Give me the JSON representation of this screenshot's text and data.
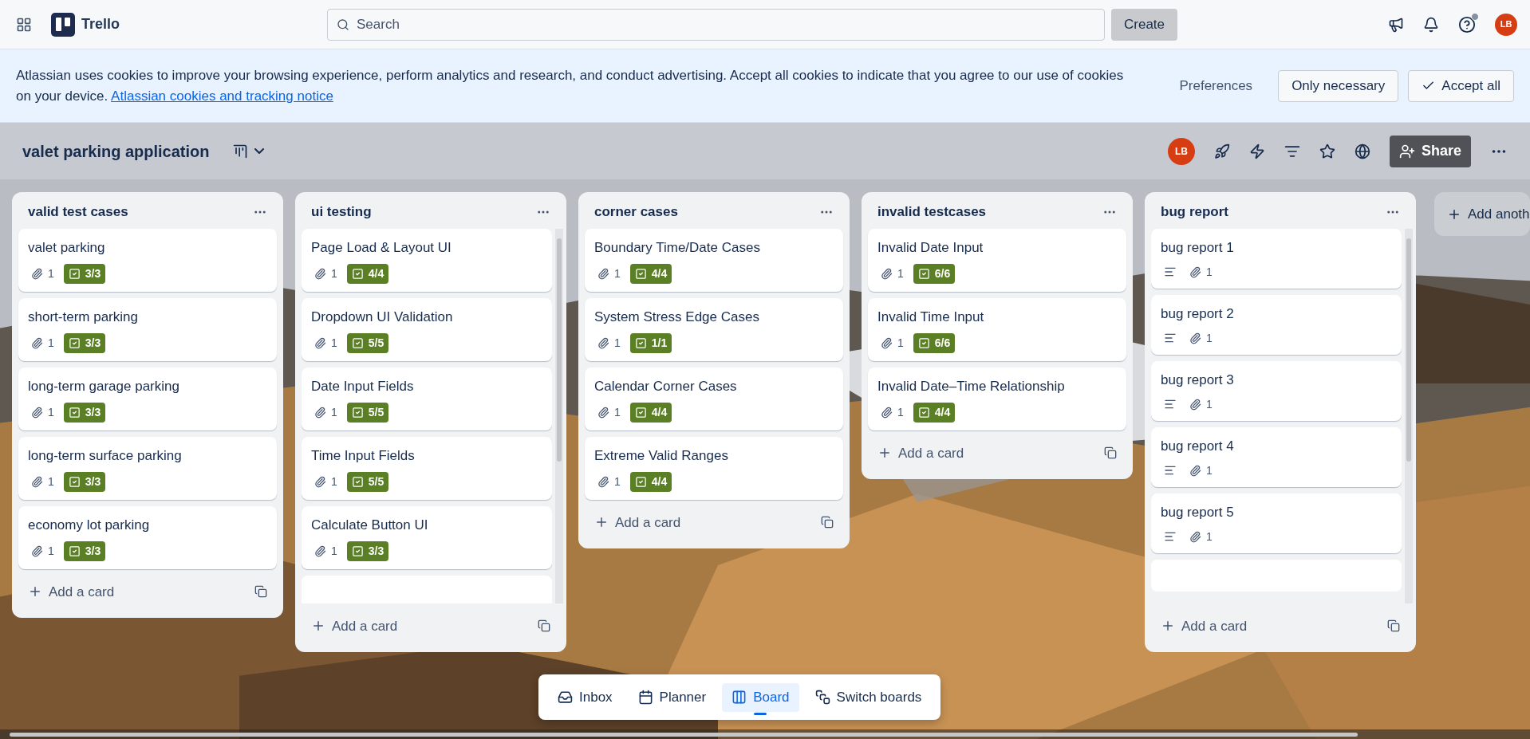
{
  "topbar": {
    "product": "Trello",
    "search": {
      "placeholder": "Search"
    },
    "create": "Create",
    "avatar": "LB",
    "help_dot": true
  },
  "cookie_banner": {
    "text": "Atlassian uses cookies to improve your browsing experience, perform analytics and research, and conduct advertising. Accept all cookies to indicate that you agree to our use of cookies on your device.",
    "link": "Atlassian cookies and tracking notice",
    "buttons": [
      {
        "label": "Preferences",
        "kind": "link"
      },
      {
        "label": "Only necessary",
        "kind": "outline"
      },
      {
        "label": "Accept all",
        "kind": "check"
      }
    ]
  },
  "board": {
    "title": "valet parking application",
    "avatar": "LB",
    "share": "Share"
  },
  "lists": [
    {
      "title": "valid test cases",
      "scroll": false,
      "add": "Add a card",
      "cards": [
        {
          "title": "valet parking",
          "badges": [
            {
              "kind": "attachment",
              "text": "1"
            },
            {
              "kind": "checklist",
              "text": "3/3"
            }
          ]
        },
        {
          "title": "short-term parking",
          "badges": [
            {
              "kind": "attachment",
              "text": "1"
            },
            {
              "kind": "checklist",
              "text": "3/3"
            }
          ]
        },
        {
          "title": "long-term garage parking",
          "badges": [
            {
              "kind": "attachment",
              "text": "1"
            },
            {
              "kind": "checklist",
              "text": "3/3"
            }
          ]
        },
        {
          "title": "long-term surface parking",
          "badges": [
            {
              "kind": "attachment",
              "text": "1"
            },
            {
              "kind": "checklist",
              "text": "3/3"
            }
          ]
        },
        {
          "title": "economy lot parking",
          "badges": [
            {
              "kind": "attachment",
              "text": "1"
            },
            {
              "kind": "checklist",
              "text": "3/3"
            }
          ]
        }
      ]
    },
    {
      "title": "ui testing",
      "scroll": true,
      "add": "Add a card",
      "cards": [
        {
          "title": "Page Load & Layout UI",
          "badges": [
            {
              "kind": "attachment",
              "text": "1"
            },
            {
              "kind": "checklist",
              "text": "4/4"
            }
          ]
        },
        {
          "title": "Dropdown UI Validation",
          "badges": [
            {
              "kind": "attachment",
              "text": "1"
            },
            {
              "kind": "checklist",
              "text": "5/5"
            }
          ]
        },
        {
          "title": "Date Input Fields",
          "badges": [
            {
              "kind": "attachment",
              "text": "1"
            },
            {
              "kind": "checklist",
              "text": "5/5"
            }
          ]
        },
        {
          "title": "Time Input Fields",
          "badges": [
            {
              "kind": "attachment",
              "text": "1"
            },
            {
              "kind": "checklist",
              "text": "5/5"
            }
          ]
        },
        {
          "title": "Calculate Button UI",
          "badges": [
            {
              "kind": "attachment",
              "text": "1"
            },
            {
              "kind": "checklist",
              "text": "3/3"
            }
          ]
        }
      ]
    },
    {
      "title": "corner cases",
      "scroll": false,
      "add": "Add a card",
      "cards": [
        {
          "title": "Boundary Time/Date Cases",
          "badges": [
            {
              "kind": "attachment",
              "text": "1"
            },
            {
              "kind": "checklist",
              "text": "4/4"
            }
          ]
        },
        {
          "title": "System Stress Edge Cases",
          "badges": [
            {
              "kind": "attachment",
              "text": "1"
            },
            {
              "kind": "checklist",
              "text": "1/1"
            }
          ]
        },
        {
          "title": "Calendar Corner Cases",
          "badges": [
            {
              "kind": "attachment",
              "text": "1"
            },
            {
              "kind": "checklist",
              "text": "4/4"
            }
          ]
        },
        {
          "title": "Extreme Valid Ranges",
          "badges": [
            {
              "kind": "attachment",
              "text": "1"
            },
            {
              "kind": "checklist",
              "text": "4/4"
            }
          ]
        }
      ]
    },
    {
      "title": "invalid testcases",
      "scroll": false,
      "add": "Add a card",
      "cards": [
        {
          "title": "Invalid Date Input",
          "badges": [
            {
              "kind": "attachment",
              "text": "1"
            },
            {
              "kind": "checklist",
              "text": "6/6"
            }
          ]
        },
        {
          "title": "Invalid Time Input",
          "badges": [
            {
              "kind": "attachment",
              "text": "1"
            },
            {
              "kind": "checklist",
              "text": "6/6"
            }
          ]
        },
        {
          "title": "Invalid Date–Time Relationship",
          "badges": [
            {
              "kind": "attachment",
              "text": "1"
            },
            {
              "kind": "checklist",
              "text": "4/4"
            }
          ]
        }
      ]
    },
    {
      "title": "bug report",
      "scroll": true,
      "add": "Add a card",
      "cards": [
        {
          "title": "bug report 1",
          "badges": [
            {
              "kind": "description"
            },
            {
              "kind": "attachment",
              "text": "1"
            }
          ]
        },
        {
          "title": "bug report 2",
          "badges": [
            {
              "kind": "description"
            },
            {
              "kind": "attachment",
              "text": "1"
            }
          ]
        },
        {
          "title": "bug report 3",
          "badges": [
            {
              "kind": "description"
            },
            {
              "kind": "attachment",
              "text": "1"
            }
          ]
        },
        {
          "title": "bug report 4",
          "badges": [
            {
              "kind": "description"
            },
            {
              "kind": "attachment",
              "text": "1"
            }
          ]
        },
        {
          "title": "bug report 5",
          "badges": [
            {
              "kind": "description"
            },
            {
              "kind": "attachment",
              "text": "1"
            }
          ]
        }
      ]
    }
  ],
  "add_list": "Add anoth",
  "bottom_nav": [
    {
      "label": "Inbox",
      "kind": "inbox",
      "selected": false
    },
    {
      "label": "Planner",
      "kind": "planner",
      "selected": false
    },
    {
      "label": "Board",
      "kind": "board",
      "selected": true
    },
    {
      "label": "Switch boards",
      "kind": "switch",
      "selected": false
    }
  ]
}
